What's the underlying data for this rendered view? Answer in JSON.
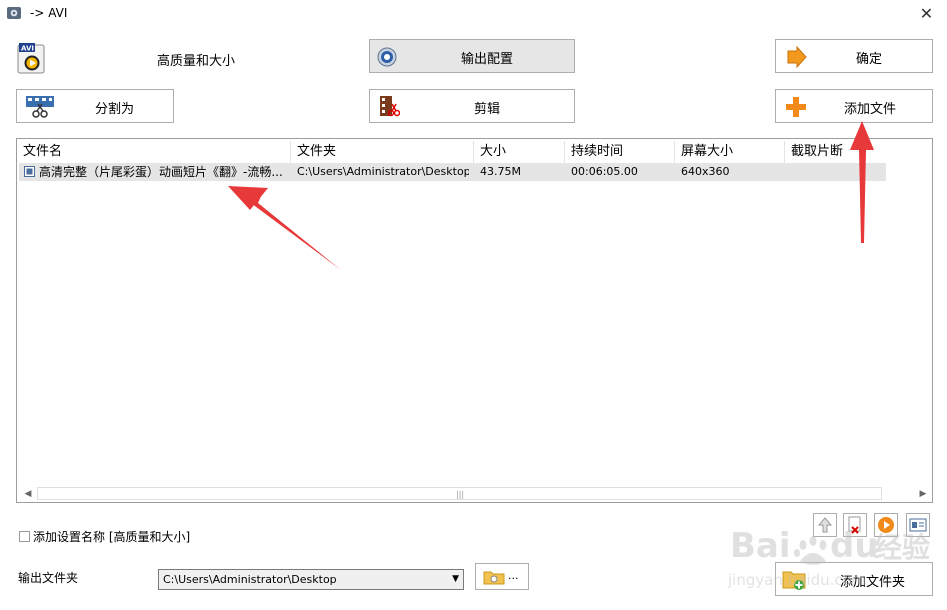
{
  "window": {
    "title": "-> AVI",
    "close_label": "✕"
  },
  "profile": {
    "label": "高质量和大小"
  },
  "buttons": {
    "output_config": "输出配置",
    "ok": "确定",
    "split": "分割为",
    "edit": "剪辑",
    "add_file": "添加文件",
    "add_folder": "添加文件夹"
  },
  "file_list": {
    "columns": [
      "文件名",
      "文件夹",
      "大小",
      "持续时间",
      "屏幕大小",
      "截取片断"
    ],
    "rows": [
      {
        "name": "高清完整（片尾彩蛋）动画短片《翻》-流畅...",
        "folder": "C:\\Users\\Administrator\\Desktop\\...",
        "size": "43.75M",
        "duration": "00:06:05.00",
        "resolution": "640x360",
        "clip": ""
      }
    ]
  },
  "options": {
    "add_setting_name_label": "添加设置名称 [高质量和大小]",
    "add_setting_name_checked": false
  },
  "output": {
    "folder_label": "输出文件夹",
    "folder_value": "C:\\Users\\Administrator\\Desktop",
    "browse_label": "..."
  },
  "watermark": {
    "text": "Baidu经验",
    "subtext": "jingyan.baidu.com"
  },
  "colors": {
    "annotation_arrow": "#e8393a",
    "selected_row": "#e5e5e5"
  }
}
